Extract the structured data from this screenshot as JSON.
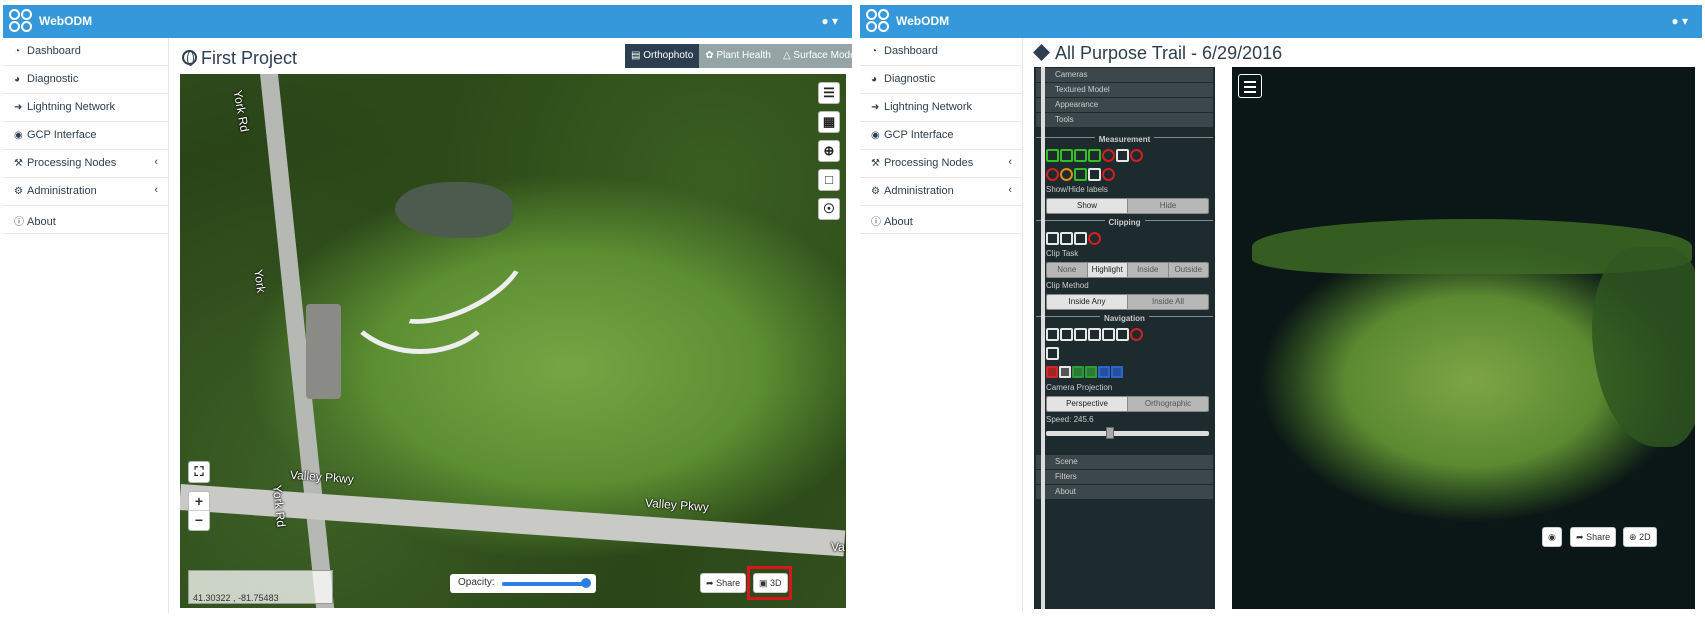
{
  "brand": "WebODM",
  "sidebar": {
    "items": [
      {
        "label": "Dashboard",
        "icon": "dashboard-icon"
      },
      {
        "label": "Diagnostic",
        "icon": "pie-chart-icon"
      },
      {
        "label": "Lightning Network",
        "icon": "bolt-icon"
      },
      {
        "label": "GCP Interface",
        "icon": "map-marker-icon"
      },
      {
        "label": "Processing Nodes",
        "icon": "wrench-icon",
        "expandable": true
      },
      {
        "label": "Administration",
        "icon": "gears-icon",
        "expandable": true
      },
      {
        "label": "About",
        "icon": "info-circle-icon"
      }
    ]
  },
  "left": {
    "title": "First Project",
    "tabs": [
      {
        "label": "Orthophoto",
        "active": true
      },
      {
        "label": "Plant Health",
        "active": false
      },
      {
        "label": "Surface Model",
        "active": false
      }
    ],
    "map_labels": {
      "road_v1": "York Rd",
      "road_v2": "York",
      "road_v3": "York Rd",
      "road_h1": "Valley Pkwy",
      "road_h2": "Valley Pkwy",
      "edge": "Va"
    },
    "zoom_in": "+",
    "zoom_out": "−",
    "coordinates": "41.30322 , -81.75483",
    "opacity_label": "Opacity:",
    "opacity_value": 1.0,
    "share_label": "Share",
    "view3d_label": "3D"
  },
  "right": {
    "title": "All Purpose Trail - 6/29/2016",
    "accordion_top": [
      "Cameras",
      "Textured Model",
      "Appearance",
      "Tools"
    ],
    "measurement_title": "Measurement",
    "show_hide_labels": "Show/Hide labels",
    "labels_buttons": [
      {
        "label": "Show",
        "selected": true
      },
      {
        "label": "Hide",
        "selected": false
      }
    ],
    "clipping_title": "Clipping",
    "clip_task_label": "Clip Task",
    "clip_task_buttons": [
      {
        "label": "None",
        "selected": false
      },
      {
        "label": "Highlight",
        "selected": true
      },
      {
        "label": "Inside",
        "selected": false
      },
      {
        "label": "Outside",
        "selected": false
      }
    ],
    "clip_method_label": "Clip Method",
    "clip_method_buttons": [
      {
        "label": "Inside Any",
        "selected": true
      },
      {
        "label": "Inside All",
        "selected": false
      }
    ],
    "navigation_title": "Navigation",
    "camera_projection_label": "Camera Projection",
    "projection_buttons": [
      {
        "label": "Perspective",
        "selected": true
      },
      {
        "label": "Orthographic",
        "selected": false
      }
    ],
    "speed_label": "Speed: 245.6",
    "accordion_bottom": [
      "Scene",
      "Filters",
      "About"
    ],
    "share_label": "Share",
    "view2d_label": "2D"
  },
  "colors": {
    "topbar": "#3498db",
    "active_tab": "#2c3e50",
    "inactive_tab": "#95a5a6",
    "highlight": "#d9141b"
  }
}
